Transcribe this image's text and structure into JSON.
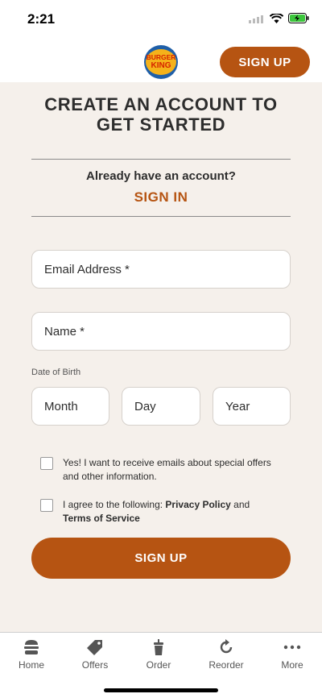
{
  "status": {
    "time": "2:21"
  },
  "header": {
    "logo_text_top": "BURGER",
    "logo_text_bottom": "KING",
    "signup_label": "SIGN UP"
  },
  "page": {
    "title": "CREATE AN ACCOUNT TO GET STARTED",
    "already_text": "Already have an account?",
    "signin_label": "SIGN IN"
  },
  "form": {
    "email_placeholder": "Email Address *",
    "name_placeholder": "Name *",
    "dob_label": "Date of Birth",
    "month_placeholder": "Month",
    "day_placeholder": "Day",
    "year_placeholder": "Year",
    "offers_text": "Yes! I want to receive emails about special offers and other information.",
    "agree_prefix": "I agree to the following: ",
    "privacy_label": "Privacy Policy",
    "and_text": " and",
    "terms_label": "Terms of Service",
    "submit_label": "SIGN UP"
  },
  "tabbar": {
    "items": [
      {
        "label": "Home",
        "icon": "burger-icon"
      },
      {
        "label": "Offers",
        "icon": "tag-icon"
      },
      {
        "label": "Order",
        "icon": "drink-icon"
      },
      {
        "label": "Reorder",
        "icon": "refresh-icon"
      },
      {
        "label": "More",
        "icon": "more-dots-icon"
      }
    ]
  },
  "colors": {
    "brand": "#b65412",
    "background": "#f5f0eb",
    "text": "#2d2d2d"
  }
}
